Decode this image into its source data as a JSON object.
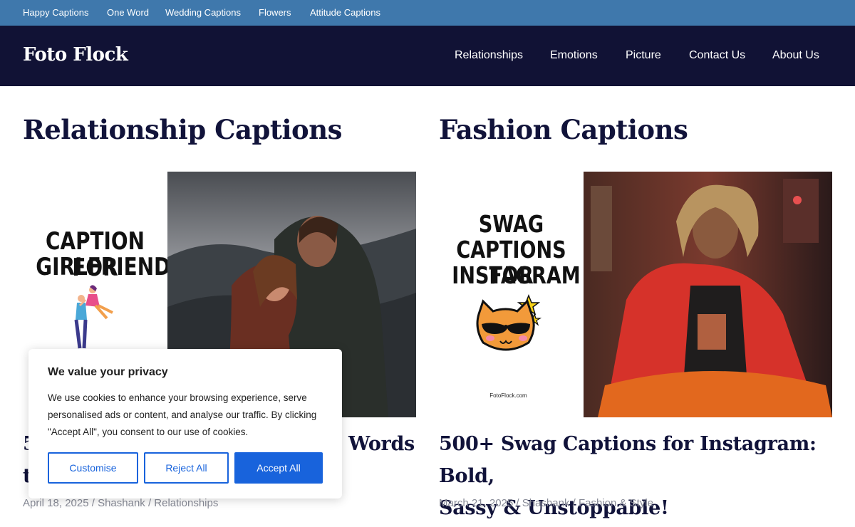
{
  "topbar": {
    "links": [
      "Happy Captions",
      "One Word",
      "Wedding Captions",
      "Flowers",
      "Attitude Captions"
    ]
  },
  "header": {
    "logo": "Foto Flock",
    "nav": [
      "Relationships",
      "Emotions",
      "Picture",
      "Contact Us",
      "About Us"
    ]
  },
  "sections": [
    {
      "title": "Relationship Captions",
      "thumb": {
        "poster_line1": "CAPTION FOR",
        "poster_line2": "GIRLFRIEND"
      },
      "post_title_line1": "5",
      "post_title_end": "Words",
      "post_title_line2": "t",
      "meta": "April 18, 2025 / Shashank / Relationships"
    },
    {
      "title": "Fashion Captions",
      "thumb": {
        "poster_line1": "SWAG",
        "poster_line2": "CAPTIONS FOR",
        "poster_line3": "INSTAGRAM",
        "site": "FotoFlock.com"
      },
      "post_title_line1": "500+ Swag Captions for Instagram: Bold,",
      "post_title_line2": "Sassy & Unstoppable!",
      "meta": "March 21, 2025 / Shashank / Fashion & Style"
    }
  ],
  "cookie": {
    "title": "We value your privacy",
    "body": "We use cookies to enhance your browsing experience, serve personalised ads or content, and analyse our traffic. By clicking \"Accept All\", you consent to our use of cookies.",
    "customise": "Customise",
    "reject": "Reject All",
    "accept": "Accept All"
  },
  "colors": {
    "topbar": "#3f78ac",
    "header": "#111235",
    "accent": "#1863dc",
    "heading": "#11133a",
    "meta": "#888b97"
  }
}
